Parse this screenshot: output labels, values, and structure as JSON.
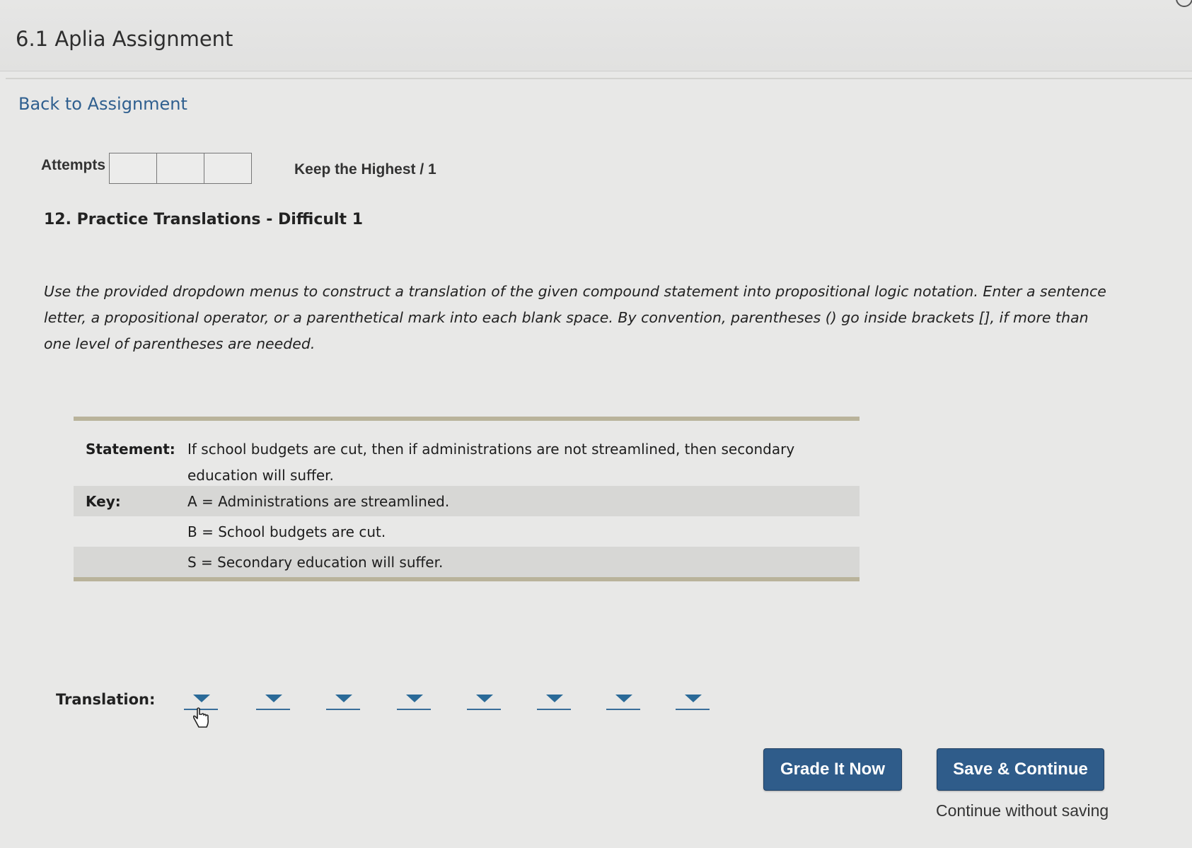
{
  "header": {
    "title": "6.1 Aplia Assignment"
  },
  "nav": {
    "back_link": "Back to Assignment"
  },
  "attempts": {
    "label": "Attempts",
    "box_count": 3,
    "policy": "Keep the Highest / 1"
  },
  "question": {
    "title": "12. Practice Translations - Difficult 1",
    "instructions": "Use the provided dropdown menus to construct a translation of the given compound statement into propositional logic notation. Enter a sentence letter, a propositional operator, or a parenthetical mark into each blank space. By convention, parentheses () go inside brackets [], if more than one level of parentheses are needed."
  },
  "statement_table": {
    "statement_label": "Statement:",
    "statement_text": "If school budgets are cut, then if administrations are not streamlined, then secondary education will suffer.",
    "key_label": "Key:",
    "key_items": [
      "A = Administrations are streamlined.",
      "B = School budgets are cut.",
      "S = Secondary education will suffer."
    ]
  },
  "translation": {
    "label": "Translation:",
    "dropdown_count": 8,
    "dropdown_icon": "chevron-down-icon",
    "selected_values": [
      "",
      "",
      "",
      "",
      "",
      "",
      "",
      ""
    ]
  },
  "buttons": {
    "grade": "Grade It Now",
    "save": "Save & Continue",
    "continue_without_saving": "Continue without saving"
  },
  "colors": {
    "accent": "#2f5c8a",
    "link": "#2f5f8f",
    "table_rule": "#b9b39b",
    "row_shade": "#d7d7d5"
  }
}
